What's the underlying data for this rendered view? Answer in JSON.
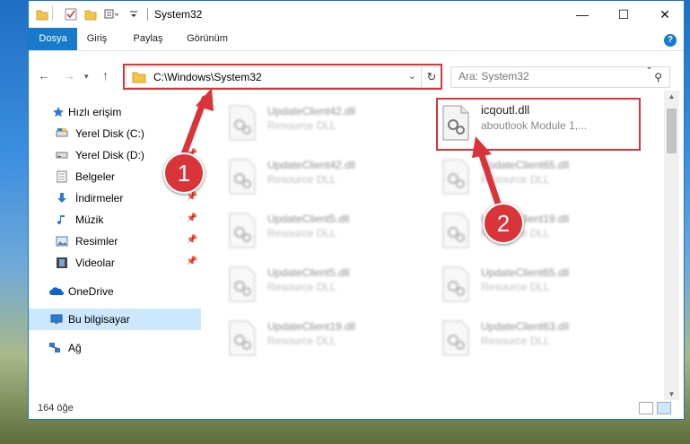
{
  "window": {
    "title": "System32",
    "controls": {
      "minimize": "—",
      "maximize": "☐",
      "close": "✕"
    }
  },
  "ribbon": {
    "tabs": [
      "Dosya",
      "Giriş",
      "Paylaş",
      "Görünüm"
    ],
    "help": "?"
  },
  "address": {
    "path": "C:\\Windows\\System32",
    "search_placeholder": "Ara: System32"
  },
  "nav": {
    "items": [
      {
        "label": "Hızlı erişim",
        "icon": "star-icon",
        "pinned": false
      },
      {
        "label": "Yerel Disk (C:)",
        "icon": "drive-icon",
        "pinned": false
      },
      {
        "label": "Yerel Disk (D:)",
        "icon": "drive-icon",
        "pinned": true
      },
      {
        "label": "Belgeler",
        "icon": "documents-icon",
        "pinned": true
      },
      {
        "label": "İndirmeler",
        "icon": "downloads-icon",
        "pinned": true
      },
      {
        "label": "Müzik",
        "icon": "music-icon",
        "pinned": true
      },
      {
        "label": "Resimler",
        "icon": "pictures-icon",
        "pinned": true
      },
      {
        "label": "Videolar",
        "icon": "videos-icon",
        "pinned": true
      },
      {
        "label": "OneDrive",
        "icon": "onedrive-icon",
        "pinned": false
      },
      {
        "label": "Bu bilgisayar",
        "icon": "this-pc-icon",
        "pinned": false,
        "selected": true
      },
      {
        "label": "Ağ",
        "icon": "network-icon",
        "pinned": false
      }
    ]
  },
  "files": [
    {
      "name": "UpdateClient42.dll",
      "desc": "Resource DLL",
      "blurred": true
    },
    {
      "name": "icqoutl.dll",
      "desc": "aboutlook Module 1,...",
      "blurred": false,
      "highlighted": true
    },
    {
      "name": "UpdateClient42.dll",
      "desc": "Resource DLL",
      "blurred": true
    },
    {
      "name": "UpdateClient65.dll",
      "desc": "Resource DLL",
      "blurred": true
    },
    {
      "name": "UpdateClient5.dll",
      "desc": "Resource DLL",
      "blurred": true
    },
    {
      "name": "UpdateClient19.dll",
      "desc": "Resource DLL",
      "blurred": true
    },
    {
      "name": "UpdateClient5.dll",
      "desc": "Resource DLL",
      "blurred": true
    },
    {
      "name": "UpdateClient65.dll",
      "desc": "Resource DLL",
      "blurred": true
    },
    {
      "name": "UpdateClient19.dll",
      "desc": "Resource DLL",
      "blurred": true
    },
    {
      "name": "UpdateClient63.dll",
      "desc": "Resource DLL",
      "blurred": true
    }
  ],
  "status": {
    "count": "164 öğe"
  },
  "callouts": [
    "1",
    "2"
  ],
  "colors": {
    "accent": "#1979ca",
    "callout": "#d9343a",
    "selected": "#cce8ff"
  }
}
